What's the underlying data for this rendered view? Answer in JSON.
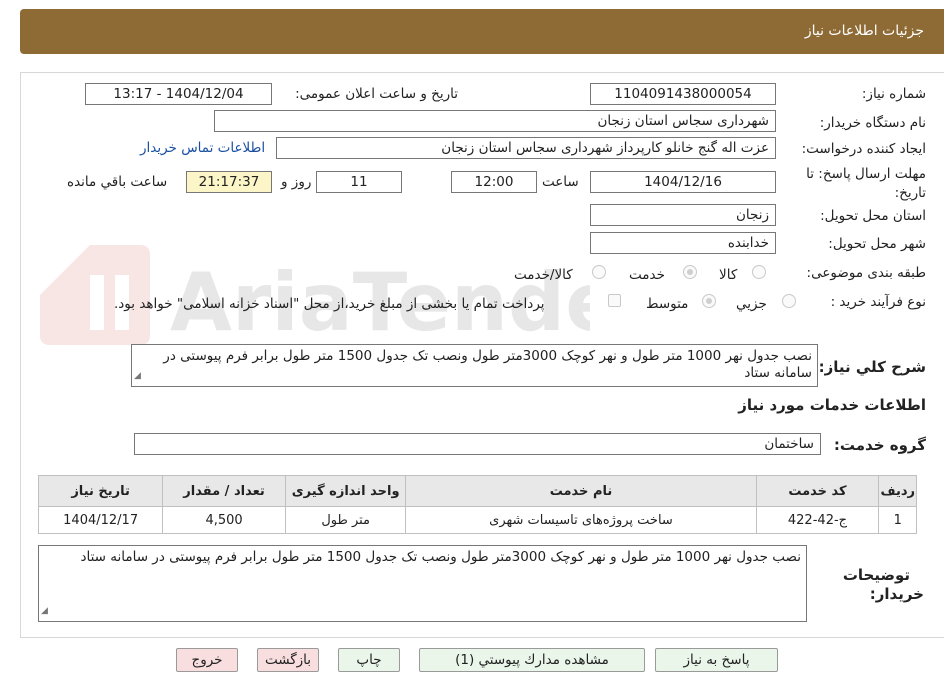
{
  "header": {
    "title": "جزئیات اطلاعات نیاز"
  },
  "form": {
    "need_number_label": "شماره نیاز:",
    "need_number": "1104091438000054",
    "announce_label": "تاریخ و ساعت اعلان عمومی:",
    "announce_value": "1404/12/04 - 13:17",
    "buyer_org_label": "نام دستگاه خریدار:",
    "buyer_org": "شهرداری سجاس استان زنجان",
    "creator_label": "ایجاد کننده درخواست:",
    "creator": "عزت اله گنج خانلو کارپرداز شهرداری سجاس استان زنجان",
    "contact_link": "اطلاعات تماس خریدار",
    "deadline_label_1": "مهلت ارسال پاسخ: تا",
    "deadline_label_2": "تاریخ:",
    "deadline_date": "1404/12/16",
    "time_label": "ساعت",
    "deadline_time": "12:00",
    "days": "11",
    "days_label": "روز و",
    "remaining_time": "21:17:37",
    "remaining_label": "ساعت باقي مانده",
    "province_label": "استان محل تحویل:",
    "province": "زنجان",
    "city_label": "شهر محل تحویل:",
    "city": "خدابنده",
    "category_label": "طبقه بندی موضوعی:",
    "category_options": [
      "کالا",
      "خدمت",
      "کالا/خدمت"
    ],
    "purchase_type_label": "نوع فرآیند خرید :",
    "purchase_options": [
      "جزیي",
      "متوسط"
    ],
    "payment_note": "پرداخت تمام یا بخشی از مبلغ خرید،از محل \"اسناد خزانه اسلامی\" خواهد بود.",
    "description_label": "شرح کلي نياز:",
    "description": "نصب جدول نهر 1000 متر طول و نهر کوچک 3000متر طول ونصب تک جدول 1500 متر طول برابر فرم پیوستی در سامانه ستاد"
  },
  "services": {
    "section_title": "اطلاعات خدمات مورد نیاز",
    "group_label": "گروه خدمت:",
    "group_value": "ساختمان",
    "columns": [
      "ردیف",
      "کد خدمت",
      "نام خدمت",
      "واحد اندازه گیری",
      "تعداد / مقدار",
      "تاریخ نیاز"
    ],
    "rows": [
      [
        "1",
        "ج-42-422",
        "ساخت پروژه‌های تاسیسات شهری",
        "متر طول",
        "4,500",
        "1404/12/17"
      ]
    ]
  },
  "buyer_notes": {
    "label_1": "توضیحات",
    "label_2": "خریدار:",
    "text": "نصب جدول نهر 1000 متر طول و نهر کوچک 3000متر طول ونصب تک جدول 1500 متر طول برابر فرم پیوستی در سامانه ستاد"
  },
  "buttons": {
    "reply": "پاسخ به نیاز",
    "view_docs": "مشاهده مدارك پیوستي (1)",
    "print": "چاپ",
    "back": "بازگشت",
    "exit": "خروج"
  },
  "colors": {
    "header": "#8e6a35",
    "link": "#1a4fa0",
    "timer_bg": "#fbf5c8"
  }
}
